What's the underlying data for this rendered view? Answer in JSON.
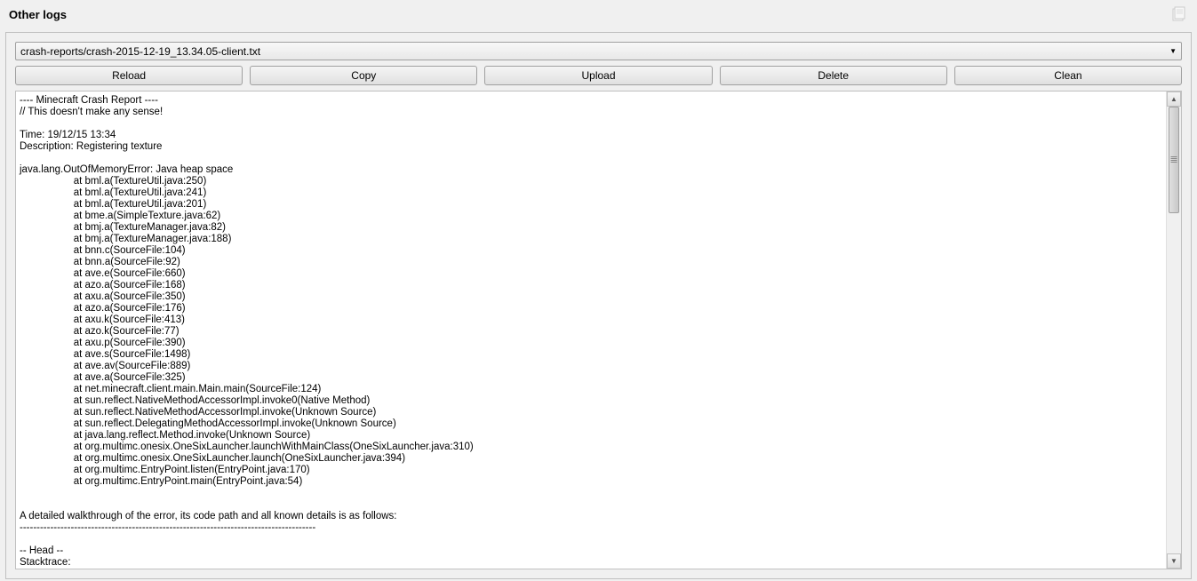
{
  "header": {
    "title": "Other logs"
  },
  "fileSelect": {
    "value": "crash-reports/crash-2015-12-19_13.34.05-client.txt"
  },
  "buttons": {
    "reload": "Reload",
    "copy": "Copy",
    "upload": "Upload",
    "delete": "Delete",
    "clean": "Clean"
  },
  "log": {
    "content": "---- Minecraft Crash Report ----\n// This doesn't make any sense!\n\nTime: 19/12/15 13:34\nDescription: Registering texture\n\njava.lang.OutOfMemoryError: Java heap space\n                   at bml.a(TextureUtil.java:250)\n                   at bml.a(TextureUtil.java:241)\n                   at bml.a(TextureUtil.java:201)\n                   at bme.a(SimpleTexture.java:62)\n                   at bmj.a(TextureManager.java:82)\n                   at bmj.a(TextureManager.java:188)\n                   at bnn.c(SourceFile:104)\n                   at bnn.a(SourceFile:92)\n                   at ave.e(SourceFile:660)\n                   at azo.a(SourceFile:168)\n                   at axu.a(SourceFile:350)\n                   at azo.a(SourceFile:176)\n                   at axu.k(SourceFile:413)\n                   at azo.k(SourceFile:77)\n                   at axu.p(SourceFile:390)\n                   at ave.s(SourceFile:1498)\n                   at ave.av(SourceFile:889)\n                   at ave.a(SourceFile:325)\n                   at net.minecraft.client.main.Main.main(SourceFile:124)\n                   at sun.reflect.NativeMethodAccessorImpl.invoke0(Native Method)\n                   at sun.reflect.NativeMethodAccessorImpl.invoke(Unknown Source)\n                   at sun.reflect.DelegatingMethodAccessorImpl.invoke(Unknown Source)\n                   at java.lang.reflect.Method.invoke(Unknown Source)\n                   at org.multimc.onesix.OneSixLauncher.launchWithMainClass(OneSixLauncher.java:310)\n                   at org.multimc.onesix.OneSixLauncher.launch(OneSixLauncher.java:394)\n                   at org.multimc.EntryPoint.listen(EntryPoint.java:170)\n                   at org.multimc.EntryPoint.main(EntryPoint.java:54)\n\n\nA detailed walkthrough of the error, its code path and all known details is as follows:\n---------------------------------------------------------------------------------------\n\n-- Head --\nStacktrace:"
  }
}
